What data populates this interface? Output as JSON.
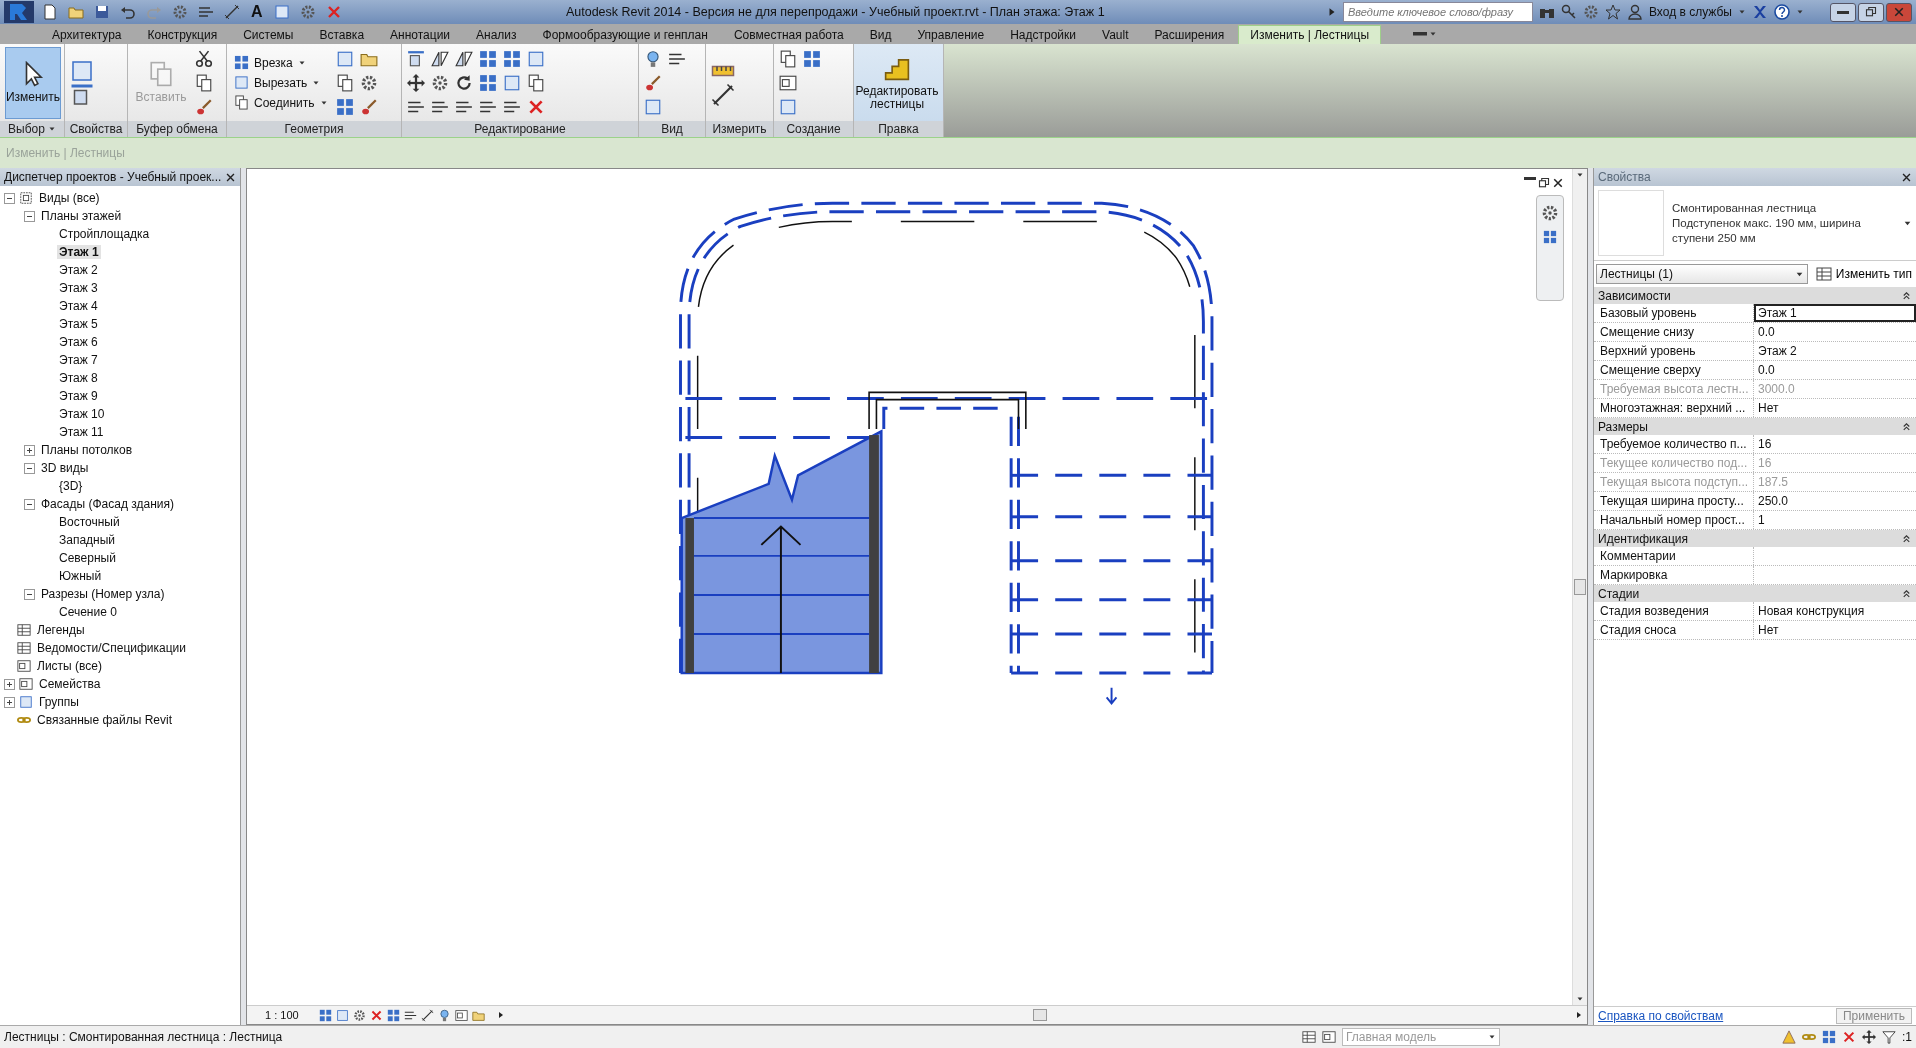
{
  "title_bar": {
    "quick_text_tool": "A",
    "title": "Autodesk Revit 2014 - Версия не для перепродажи -   Учебный проект.rvt - План этажа: Этаж 1",
    "search_placeholder": "Введите ключевое слово/фразу",
    "sign_in": "Вход в службы"
  },
  "ribbon_tabs": [
    {
      "label": "Архитектура",
      "selected": false
    },
    {
      "label": "Конструкция",
      "selected": false
    },
    {
      "label": "Системы",
      "selected": false
    },
    {
      "label": "Вставка",
      "selected": false
    },
    {
      "label": "Аннотации",
      "selected": false
    },
    {
      "label": "Анализ",
      "selected": false
    },
    {
      "label": "Формообразующие и генплан",
      "selected": false
    },
    {
      "label": "Совместная работа",
      "selected": false
    },
    {
      "label": "Вид",
      "selected": false
    },
    {
      "label": "Управление",
      "selected": false
    },
    {
      "label": "Надстройки",
      "selected": false
    },
    {
      "label": "Vault",
      "selected": false
    },
    {
      "label": "Расширения",
      "selected": false
    },
    {
      "label": "Изменить | Лестницы",
      "selected": true
    }
  ],
  "ribbon_panels": [
    {
      "label": "Выбор",
      "tools": [
        {
          "kind": "large",
          "label": "Изменить",
          "selected": true,
          "disabled": false
        }
      ]
    },
    {
      "label": "Свойства"
    },
    {
      "label": "Буфер обмена",
      "tools": [
        {
          "kind": "large",
          "label": "Вставить",
          "selected": false,
          "disabled": true
        }
      ]
    },
    {
      "label": "Геометрия",
      "tools": [
        {
          "kind": "small",
          "label": "Врезка"
        },
        {
          "kind": "small",
          "label": "Вырезать"
        },
        {
          "kind": "small",
          "label": "Соединить"
        }
      ]
    },
    {
      "label": "Редактирование"
    },
    {
      "label": "Вид"
    },
    {
      "label": "Измерить"
    },
    {
      "label": "Создание"
    },
    {
      "label": "Правка",
      "tools": [
        {
          "kind": "large",
          "label": "Редактировать лестницы",
          "selected": false,
          "disabled": false
        }
      ]
    }
  ],
  "options_bar": {
    "label": "Изменить | Лестницы"
  },
  "project_browser": {
    "title": "Диспетчер проектов - Учебный проек...",
    "tree": [
      {
        "label": "Виды (все)",
        "expanded": true,
        "selected": false,
        "children": [
          {
            "label": "Планы этажей",
            "expanded": true,
            "selected": false,
            "children": [
              {
                "label": "Стройплощадка",
                "selected": false
              },
              {
                "label": "Этаж 1",
                "selected": true
              },
              {
                "label": "Этаж 2",
                "selected": false
              },
              {
                "label": "Этаж 3",
                "selected": false
              },
              {
                "label": "Этаж 4",
                "selected": false
              },
              {
                "label": "Этаж 5",
                "selected": false
              },
              {
                "label": "Этаж 6",
                "selected": false
              },
              {
                "label": "Этаж 7",
                "selected": false
              },
              {
                "label": "Этаж 8",
                "selected": false
              },
              {
                "label": "Этаж 9",
                "selected": false
              },
              {
                "label": "Этаж 10",
                "selected": false
              },
              {
                "label": "Этаж 11",
                "selected": false
              }
            ]
          },
          {
            "label": "Планы потолков",
            "expanded": false,
            "selected": false
          },
          {
            "label": "3D виды",
            "expanded": true,
            "selected": false,
            "children": [
              {
                "label": "{3D}",
                "selected": false
              }
            ]
          },
          {
            "label": "Фасады (Фасад здания)",
            "expanded": true,
            "selected": false,
            "children": [
              {
                "label": "Восточный",
                "selected": false
              },
              {
                "label": "Западный",
                "selected": false
              },
              {
                "label": "Северный",
                "selected": false
              },
              {
                "label": "Южный",
                "selected": false
              }
            ]
          },
          {
            "label": "Разрезы (Номер узла)",
            "expanded": true,
            "selected": false,
            "children": [
              {
                "label": "Сечение 0",
                "selected": false
              }
            ]
          }
        ]
      },
      {
        "label": "Легенды",
        "selected": false
      },
      {
        "label": "Ведомости/Спецификации",
        "selected": false
      },
      {
        "label": "Листы (все)",
        "selected": false
      },
      {
        "label": "Семейства",
        "expanded": false,
        "selected": false
      },
      {
        "label": "Группы",
        "expanded": false,
        "selected": false
      },
      {
        "label": "Связанные файлы Revit",
        "selected": false
      }
    ]
  },
  "view": {
    "scale": "1 : 100"
  },
  "properties": {
    "title": "Свойства",
    "family": "Смонтированная лестница",
    "type": "Подступенок макс. 190 мм, ширина ступени 250 мм",
    "selector": "Лестницы (1)",
    "edit_type": "Изменить тип",
    "groups": [
      {
        "name": "Зависимости",
        "rows": [
          {
            "label": "Базовый уровень",
            "value": "Этаж 1",
            "disabled": false,
            "active": true
          },
          {
            "label": "Смещение снизу",
            "value": "0.0",
            "disabled": false,
            "active": false
          },
          {
            "label": "Верхний уровень",
            "value": "Этаж 2",
            "disabled": false,
            "active": false
          },
          {
            "label": "Смещение сверху",
            "value": "0.0",
            "disabled": false,
            "active": false
          },
          {
            "label": "Требуемая высота лестн...",
            "value": "3000.0",
            "disabled": true,
            "active": false
          },
          {
            "label": "Многоэтажная: верхний ...",
            "value": "Нет",
            "disabled": false,
            "active": false
          }
        ]
      },
      {
        "name": "Размеры",
        "rows": [
          {
            "label": "Требуемое количество п...",
            "value": "16",
            "disabled": false,
            "active": false
          },
          {
            "label": "Текущее количество под...",
            "value": "16",
            "disabled": true,
            "active": false
          },
          {
            "label": "Текущая высота подступ...",
            "value": "187.5",
            "disabled": true,
            "active": false
          },
          {
            "label": "Текущая ширина просту...",
            "value": "250.0",
            "disabled": false,
            "active": false
          },
          {
            "label": "Начальный номер прост...",
            "value": "1",
            "disabled": false,
            "active": false
          }
        ]
      },
      {
        "name": "Идентификация",
        "rows": [
          {
            "label": "Комментарии",
            "disabled": false
          },
          {
            "label": "Маркировка",
            "disabled": false
          }
        ]
      },
      {
        "name": "Стадии",
        "rows": [
          {
            "label": "Стадия возведения",
            "value": "Новая конструкция",
            "disabled": false,
            "active": false
          },
          {
            "label": "Стадия сноса",
            "value": "Нет",
            "disabled": false,
            "active": false
          }
        ]
      }
    ],
    "help_link": "Справка по свойствам",
    "apply": "Применить"
  },
  "status_bar": {
    "text": "Лестницы : Смонтированная лестница : Лестница",
    "model": "Главная модель",
    "filter_count": ":1"
  }
}
